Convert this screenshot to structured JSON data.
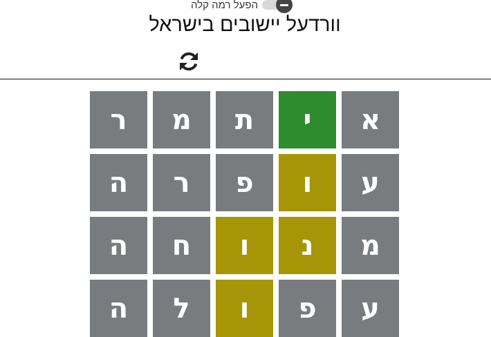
{
  "header": {
    "toggle_label": "הפעל רמה קלה",
    "title": "וורדעל יישובים בישראל",
    "refresh_icon": "refresh-icon"
  },
  "colors": {
    "absent": "#787c7e",
    "present": "#a69607",
    "correct": "#2e8b2e"
  },
  "board": {
    "rows": [
      [
        {
          "letter": "ר",
          "state": "absent"
        },
        {
          "letter": "מ",
          "state": "absent"
        },
        {
          "letter": "ת",
          "state": "absent"
        },
        {
          "letter": "י",
          "state": "correct"
        },
        {
          "letter": "א",
          "state": "absent"
        }
      ],
      [
        {
          "letter": "ה",
          "state": "absent"
        },
        {
          "letter": "ר",
          "state": "absent"
        },
        {
          "letter": "פ",
          "state": "absent"
        },
        {
          "letter": "ו",
          "state": "present"
        },
        {
          "letter": "ע",
          "state": "absent"
        }
      ],
      [
        {
          "letter": "ה",
          "state": "absent"
        },
        {
          "letter": "ח",
          "state": "absent"
        },
        {
          "letter": "ו",
          "state": "present"
        },
        {
          "letter": "נ",
          "state": "present"
        },
        {
          "letter": "מ",
          "state": "absent"
        }
      ],
      [
        {
          "letter": "ה",
          "state": "absent"
        },
        {
          "letter": "ל",
          "state": "absent"
        },
        {
          "letter": "ו",
          "state": "present"
        },
        {
          "letter": "פ",
          "state": "absent"
        },
        {
          "letter": "ע",
          "state": "absent"
        }
      ]
    ]
  }
}
